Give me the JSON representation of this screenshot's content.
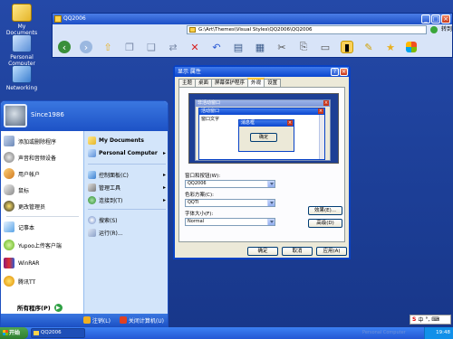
{
  "desktop": {
    "icons": [
      {
        "label": "My Documents"
      },
      {
        "label": "Personal Computer"
      },
      {
        "label": "Networking"
      }
    ]
  },
  "explorer": {
    "title": "QQ2006",
    "address": "G:\\Art\\Themes\\Visual Styles\\QQ2006\\QQ2006",
    "go_label": "转到",
    "toolbar_icons": [
      "back-icon",
      "forward-icon",
      "up-icon",
      "copy-icon",
      "paste-icon",
      "move-icon",
      "delete-icon",
      "undo-icon",
      "properties-icon",
      "views-icon",
      "cut-icon",
      "copy-to-icon",
      "paste-to-icon",
      "folders-icon",
      "favorites-icon",
      "star-icon",
      "windows-logo-icon"
    ]
  },
  "dialog": {
    "title": "显示 属性",
    "tabs": [
      "主题",
      "桌面",
      "屏幕保护程序",
      "外观",
      "设置"
    ],
    "active_tab": "外观",
    "preview": {
      "inactive_title": "非活动窗口",
      "active_title": "活动窗口",
      "window_text": "窗口文字",
      "message_title": "消息框",
      "ok_label": "确定"
    },
    "labels": {
      "windows_buttons": "窗口和按钮(W):",
      "color_scheme": "色彩方案(C):",
      "font_size": "字体大小(F):"
    },
    "values": {
      "windows_buttons": "QQ2006",
      "color_scheme": "QQTI",
      "font_size": "Normal"
    },
    "buttons": {
      "effects": "效果(E)...",
      "advanced": "高级(D)",
      "ok": "确定",
      "cancel": "取消",
      "apply": "应用(A)"
    }
  },
  "startmenu": {
    "username": "Since1986",
    "left_items": [
      {
        "label": "添加或删除程序"
      },
      {
        "label": "声音和音频设备"
      },
      {
        "label": "用户帐户"
      },
      {
        "label": "鼠标"
      },
      {
        "label": "更改管理员"
      },
      {
        "label": "记事本"
      },
      {
        "label": "Yupoo上传客户端"
      },
      {
        "label": "WinRAR"
      },
      {
        "label": "腾讯TT"
      }
    ],
    "all_programs": "所有程序(P)",
    "right_items": [
      {
        "label": "My Documents"
      },
      {
        "label": "Personal Computer"
      },
      {
        "label": "控制面板(C)"
      },
      {
        "label": "管理工具"
      },
      {
        "label": "连接到(T)"
      },
      {
        "label": "搜索(S)"
      },
      {
        "label": "运行(R)..."
      }
    ],
    "logoff": "注销(L)",
    "shutdown": "关闭计算机(U)"
  },
  "taskbar": {
    "start_label": "开始",
    "task_label": "QQ2006",
    "tray_label": "Personal Computer",
    "clock": "19:48",
    "ime_label": "中"
  }
}
